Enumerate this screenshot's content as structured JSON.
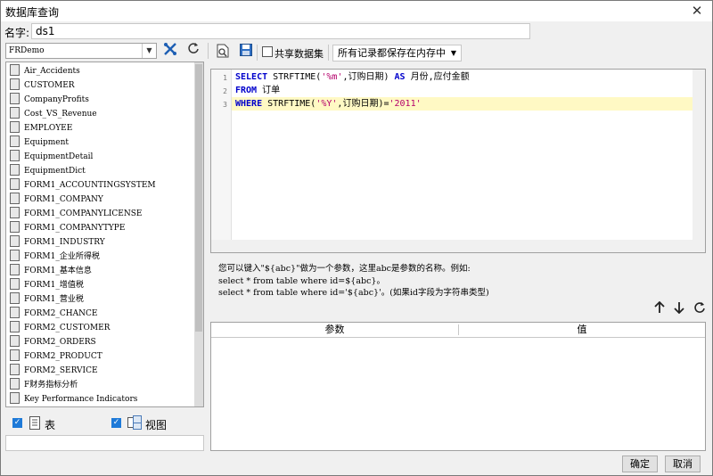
{
  "window": {
    "title": "数据库查询",
    "close_glyph": "✕"
  },
  "name_field": {
    "label": "名字:",
    "value": "ds1"
  },
  "left_panel": {
    "database_select": "FRDemo",
    "tables": [
      "Air_Accidents",
      "CUSTOMER",
      "CompanyProfits",
      "Cost_VS_Revenue",
      "EMPLOYEE",
      "Equipment",
      "EquipmentDetail",
      "EquipmentDict",
      "FORM1_ACCOUNTINGSYSTEM",
      "FORM1_COMPANY",
      "FORM1_COMPANYLICENSE",
      "FORM1_COMPANYTYPE",
      "FORM1_INDUSTRY",
      "FORM1_企业所得税",
      "FORM1_基本信息",
      "FORM1_增值税",
      "FORM1_营业税",
      "FORM2_CHANCE",
      "FORM2_CUSTOMER",
      "FORM2_ORDERS",
      "FORM2_PRODUCT",
      "FORM2_SERVICE",
      "F财务指标分析",
      "Key Performance Indicators"
    ],
    "filter_table_label": "表",
    "filter_view_label": "视图"
  },
  "toolbar": {
    "share_label": "共享数据集",
    "mode_value": "所有记录都保存在内存中"
  },
  "editor": {
    "line_numbers": [
      "1",
      "2",
      "3"
    ],
    "line1": {
      "k1": "SELECT",
      "f1": " STRFTIME(",
      "s1": "'%m'",
      "t1": ",订购日期)",
      "k2": " AS",
      "t2": " 月份,应付金额"
    },
    "line2": {
      "k1": "FROM",
      "t1": " 订单"
    },
    "line3": {
      "k1": "WHERE",
      "f1": " STRFTIME(",
      "s1": "'%Y'",
      "t1": ",订购日期)=",
      "s2": "'2011'"
    }
  },
  "help": {
    "line1": "您可以键入\"${abc}\"做为一个参数，这里abc是参数的名称。例如:",
    "line2": "select * from table where id=${abc}。",
    "line3": "select * from table where id='${abc}'。(如果id字段为字符串类型)"
  },
  "params_table": {
    "col_param": "参数",
    "col_value": "值"
  },
  "footer": {
    "ok": "确定",
    "cancel": "取消"
  }
}
